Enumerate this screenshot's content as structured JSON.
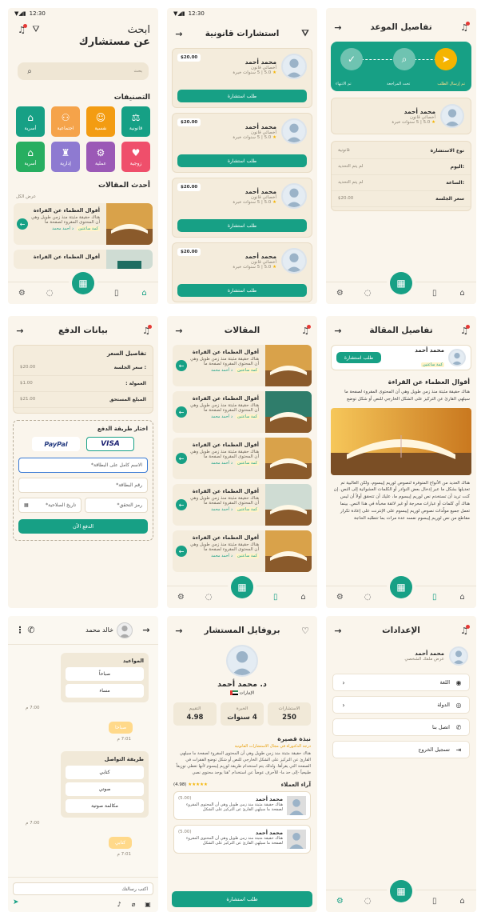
{
  "status_time": "12:30",
  "s1": {
    "title_l1": "ابحث",
    "title_l2": "عن مستشارك",
    "search_ph": "بحث",
    "cat_title": "التصنيفات",
    "cats": [
      {
        "label": "قانونية",
        "color": "#16a085"
      },
      {
        "label": "نفسية",
        "color": "#f39c12"
      },
      {
        "label": "اجتماعية",
        "color": "#f5a34a"
      },
      {
        "label": "أسرية",
        "color": "#17a085"
      },
      {
        "label": "زوجية",
        "color": "#ef4f6b"
      },
      {
        "label": "عملية",
        "color": "#9b59b6"
      },
      {
        "label": "إدارية",
        "color": "#8e7ad1"
      },
      {
        "label": "أسرية",
        "color": "#27ae60"
      }
    ],
    "articles_title": "أحدث المقالات",
    "see_all": "عرض الكل",
    "article": {
      "title": "أقوال العظماء عن القراءة",
      "body": "هناك حقيقة مثبتة منذ زمن طويل وهي أن المحتوى المقروء لصفحة ما",
      "tag": "كمة ساعتين",
      "author": "د أحمد محمد"
    }
  },
  "s2": {
    "title": "استشارات قانونية",
    "lawyer": {
      "name": "محمد أحمد",
      "role": "أخصائي قانون",
      "rating": "5.0",
      "exp": "5 سنوات خبرة",
      "price": "$20.00",
      "cta": "طلب استشارة"
    }
  },
  "s3": {
    "title": "تفاصيل الموعد",
    "steps": [
      "تم إرسال الطلب",
      "تحت المراجعة",
      "تم الانتهاء"
    ],
    "name": "محمد أحمد",
    "role": "أخصائي قانون",
    "rating": "5.0",
    "exp": "5 سنوات خبرة",
    "rows": [
      {
        "k": "نوع الاستشارة",
        "v": "قانونية"
      },
      {
        "k": ":اليوم",
        "v": "لم يتم التحديد"
      },
      {
        "k": ":الساعة",
        "v": "لم يتم التحديد"
      },
      {
        "k": "سعر الجلسة",
        "v": "$20.00"
      }
    ]
  },
  "s4": {
    "title": "بيانات الدفع",
    "price_title": "تفاصيل السعر",
    "rows": [
      {
        "k": ": سعر الجلسة",
        "v": "$20.00"
      },
      {
        "k": "العمولة :",
        "v": "$1.00"
      },
      {
        "k": "المبلغ المستحق",
        "v": "$21.00"
      }
    ],
    "method_title": "اختار طريقة الدفع",
    "paypal": "PayPal",
    "visa": "VISA",
    "name_ph": "الاسم كامل على البطاقة*",
    "card_ph": "رقم البطاقة*",
    "exp_ph": "تاريخ الصلاحية*",
    "cvv_ph": "رمز التحقق*",
    "pay": "الدفع الآن"
  },
  "s5": {
    "title": "المقالات"
  },
  "s6": {
    "title": "تفاصيل المقالة",
    "author": "محمد أحمد",
    "author_tag": "كمة ساعتين",
    "cta": "طلب استشارة",
    "art_title": "أقوال العظماء عن القراءة",
    "p1": "هناك حقيقة مثبتة منذ زمن طويل وهي أن المحتوى المقروء لصفحة ما سيلهي القارئ عن التركيز على الشكل الخارجي للنص أو شكل توضع",
    "p2": "هناك العديد من الأنواع المتوفرة لنصوص لوريم إيبسوم، ولكن الغالبية تم تعديلها بشكل ما عبر إدخال بعض النوادر أو الكلمات العشوائية إلى النص. إن كنت تريد أن تستخدم نص لوريم إيبسوم ما، عليك أن تتحقق أولاً أن ليس هناك أي كلمات أو عبارات محرجة أو غير لائقة مخبأة في هذا النص. بينما تعمل جميع مولّدات نصوص لوريم إيبسوم على الإنترنت على إعادة تكرار مقاطع من نص لوريم إيبسوم نفسه عدة مرات بما تتطلبه الحاجة"
  },
  "s7": {
    "name": "خالد محمد",
    "dates_title": "المواعيد",
    "morning": "صباحاً",
    "evening": "مساء",
    "time1": "7:00 م",
    "reply1": "صباحا",
    "time2": "7:01 م",
    "contact_title": "طريقة التواصل",
    "text": "كتابي",
    "voice": "صوتي",
    "call": "مكالمة صوتية",
    "time3": "7:00 م",
    "reply2": "كتابي",
    "time4": "7:01 م",
    "input_ph": "اكتب رسالتك"
  },
  "s8": {
    "title": "بروفايل المستشار",
    "name": "د. محمد أحمد",
    "country": "الإمارات",
    "stats": [
      {
        "k": "الاستشارات",
        "v": "250"
      },
      {
        "k": "الخبرة",
        "v": "4 سنوات"
      },
      {
        "k": "التقييم",
        "v": "4.98"
      }
    ],
    "bio_title": "نبذة قصيرة",
    "bio_sub": "درجة الدكتوراة في مجال الاستشارات القانونية",
    "bio": "هناك حقيقة مثبتة منذ زمن طويل وهي أن المحتوى المقروء لصفحة ما سيلهي القارئ عن التركيز على الشكل الخارجي للنص أو شكل توضع الفقرات في الصفحة التي يقرأها. ولذلك يتم استخدام طريقة لوريم إيبسوم لأنها تعطي توزيعاً طبيعياً -إلى حد ما- للأحرف عوضاً عن استخدام \"هنا يوجد محتوى نصي",
    "reviews_title": "آراء العملاء",
    "reviews_score": "(4.98)",
    "reviewer": "محمد أحمد",
    "review_score": "(5.00)",
    "review": "هناك حقيقة مثبتة منذ زمن طويل وهي أن المحتوى المقروء لصفحة ما سيلهي القارئ عن التركيز على الشكل",
    "cta": "طلب استشارة"
  },
  "s9": {
    "title": "الإعدادات",
    "name": "محمد أحمد",
    "sub": "عرض ملفك الشخصي",
    "items": [
      "اللغة",
      "الدولة",
      "اتصل بنا",
      "تسجيل الخروج"
    ]
  }
}
